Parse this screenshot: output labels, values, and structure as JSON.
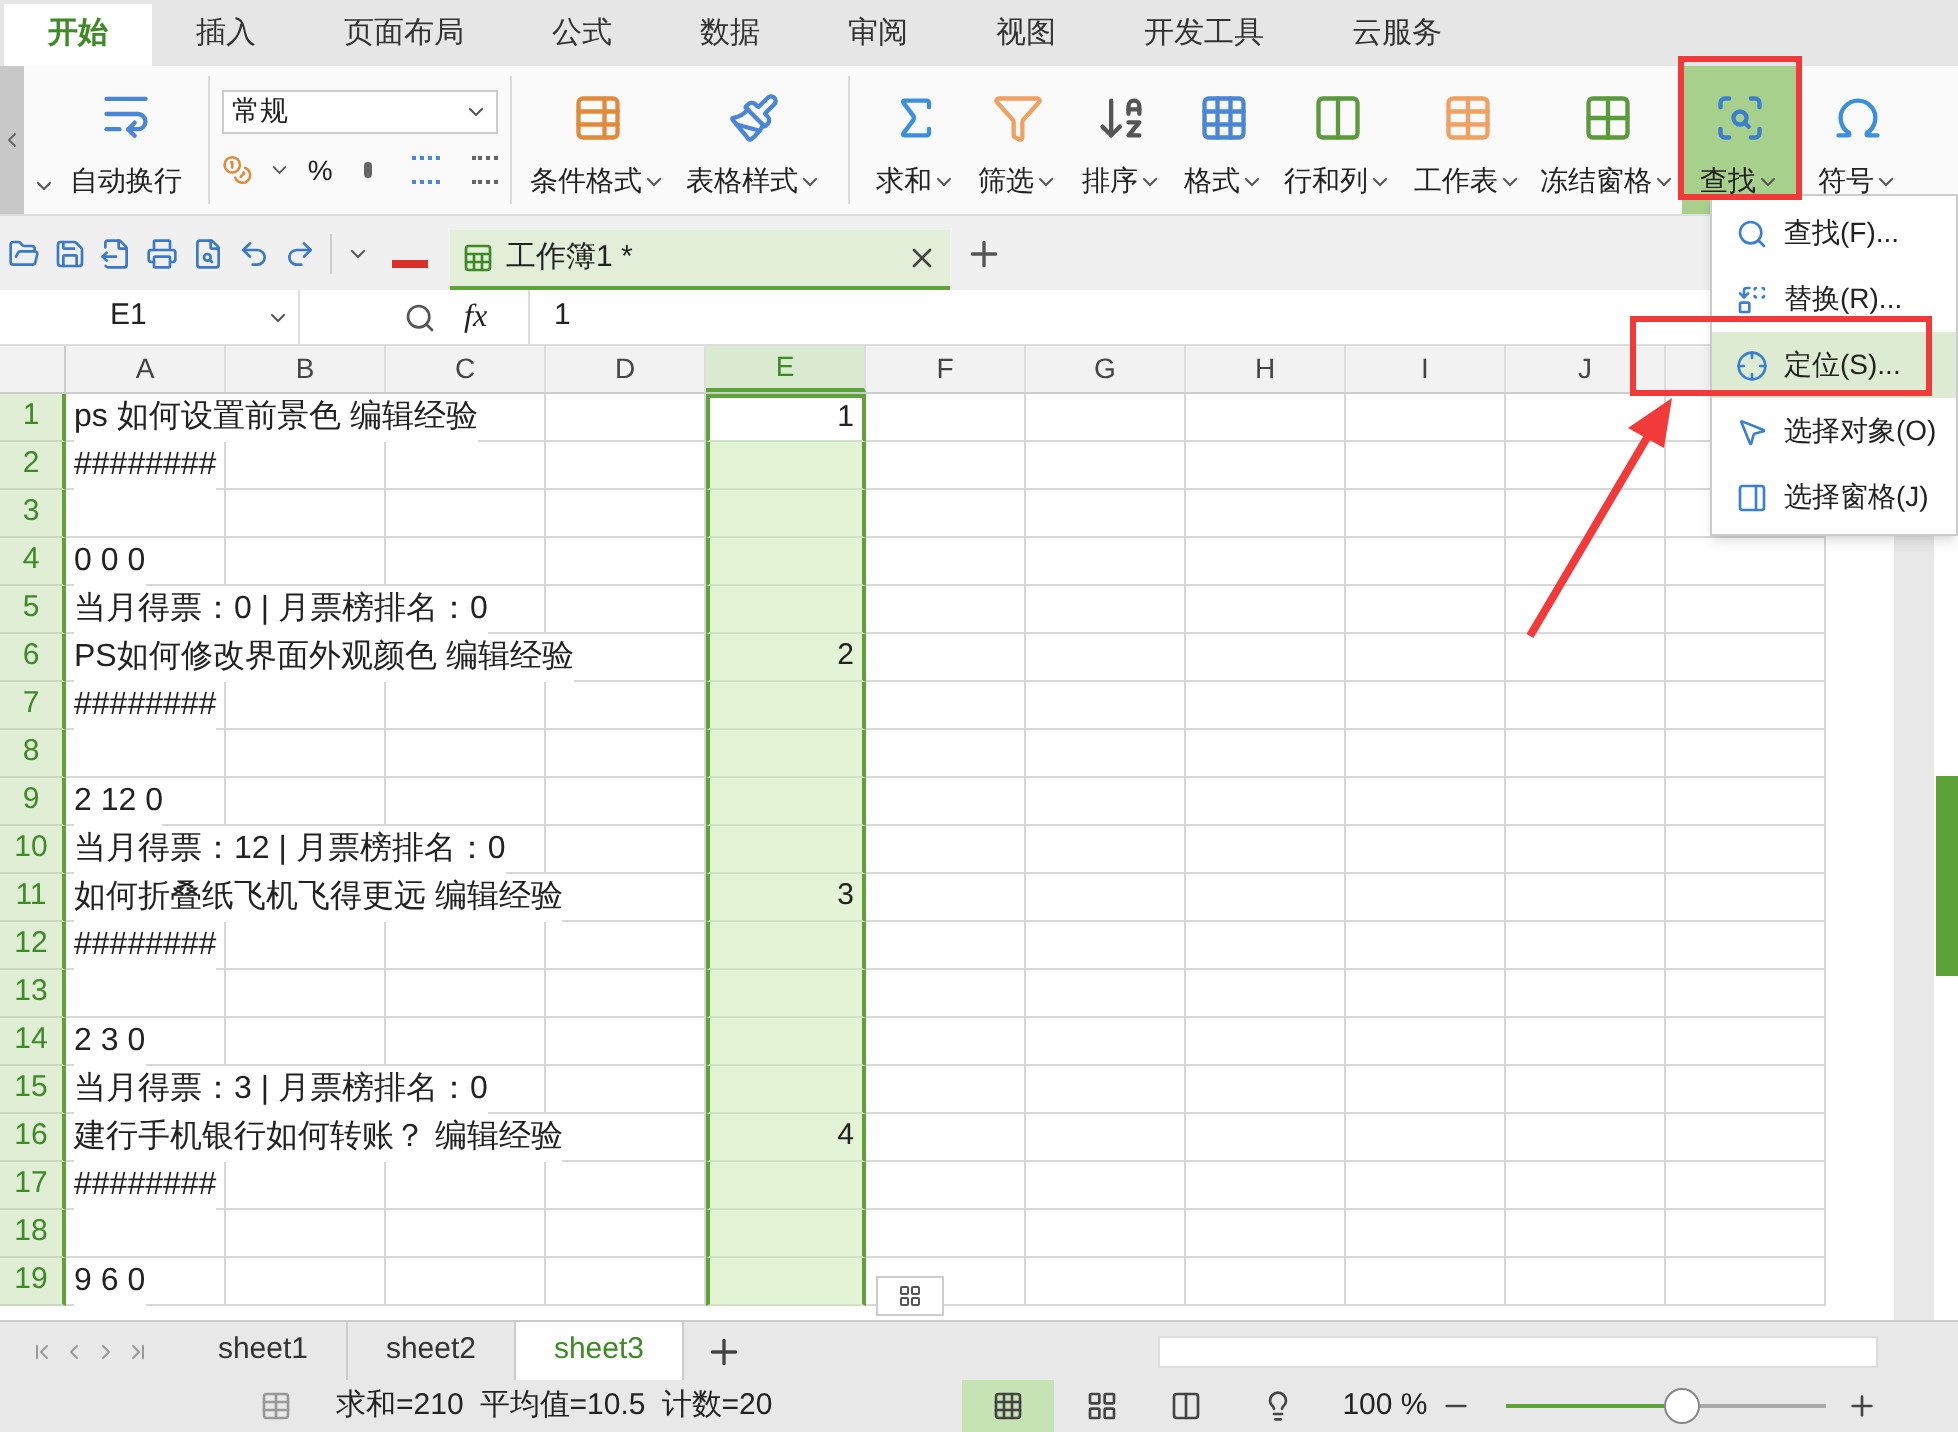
{
  "ribbon_tabs": [
    {
      "label": "开始",
      "selected": true
    },
    {
      "label": "插入",
      "selected": false
    },
    {
      "label": "页面布局",
      "selected": false
    },
    {
      "label": "公式",
      "selected": false
    },
    {
      "label": "数据",
      "selected": false
    },
    {
      "label": "审阅",
      "selected": false
    },
    {
      "label": "视图",
      "selected": false
    },
    {
      "label": "开发工具",
      "selected": false
    },
    {
      "label": "云服务",
      "selected": false
    }
  ],
  "ribbon": {
    "wrap_button": "自动换行",
    "number_format": "常规",
    "percent": "%",
    "buttons": [
      {
        "label": "条件格式",
        "selected": false
      },
      {
        "label": "表格样式",
        "selected": false
      },
      {
        "label": "求和",
        "selected": false
      },
      {
        "label": "筛选",
        "selected": false
      },
      {
        "label": "排序",
        "selected": false
      },
      {
        "label": "格式",
        "selected": false
      },
      {
        "label": "行和列",
        "selected": false
      },
      {
        "label": "工作表",
        "selected": false
      },
      {
        "label": "冻结窗格",
        "selected": false
      },
      {
        "label": "查找",
        "selected": true
      },
      {
        "label": "符号",
        "selected": false
      }
    ]
  },
  "document_tab": {
    "title": "工作簿1 *"
  },
  "formula_bar": {
    "name_box": "E1",
    "fx": "fx",
    "value": "1"
  },
  "columns": [
    {
      "label": "A",
      "selected": false
    },
    {
      "label": "B",
      "selected": false
    },
    {
      "label": "C",
      "selected": false
    },
    {
      "label": "D",
      "selected": false
    },
    {
      "label": "E",
      "selected": true
    },
    {
      "label": "F",
      "selected": false
    },
    {
      "label": "G",
      "selected": false
    },
    {
      "label": "H",
      "selected": false
    },
    {
      "label": "I",
      "selected": false
    },
    {
      "label": "J",
      "selected": false
    }
  ],
  "rows": [
    {
      "number": "1",
      "a": "ps 如何设置前景色 编辑经验",
      "e": "1"
    },
    {
      "number": "2",
      "a": "########",
      "e": ""
    },
    {
      "number": "3",
      "a": "",
      "e": ""
    },
    {
      "number": "4",
      "a": "0 0 0",
      "e": ""
    },
    {
      "number": "5",
      "a": "当月得票：0 | 月票榜排名：0",
      "e": ""
    },
    {
      "number": "6",
      "a": "PS如何修改界面外观颜色 编辑经验",
      "e": "2"
    },
    {
      "number": "7",
      "a": "########",
      "e": ""
    },
    {
      "number": "8",
      "a": "",
      "e": ""
    },
    {
      "number": "9",
      "a": "2 12 0",
      "e": ""
    },
    {
      "number": "10",
      "a": "当月得票：12 | 月票榜排名：0",
      "e": ""
    },
    {
      "number": "11",
      "a": "如何折叠纸飞机飞得更远 编辑经验",
      "e": "3"
    },
    {
      "number": "12",
      "a": "########",
      "e": ""
    },
    {
      "number": "13",
      "a": "",
      "e": ""
    },
    {
      "number": "14",
      "a": "2 3 0",
      "e": ""
    },
    {
      "number": "15",
      "a": "当月得票：3 | 月票榜排名：0",
      "e": ""
    },
    {
      "number": "16",
      "a": "建行手机银行如何转账？ 编辑经验",
      "e": "4"
    },
    {
      "number": "17",
      "a": "########",
      "e": ""
    },
    {
      "number": "18",
      "a": "",
      "e": ""
    },
    {
      "number": "19",
      "a": "9 6 0",
      "e": ""
    }
  ],
  "find_menu": [
    {
      "label": "查找(F)...",
      "selected": false
    },
    {
      "label": "替换(R)...",
      "selected": false
    },
    {
      "label": "定位(S)...",
      "selected": true
    },
    {
      "label": "选择对象(O)",
      "selected": false
    },
    {
      "label": "选择窗格(J)",
      "selected": false
    }
  ],
  "sheet_tabs": [
    {
      "label": "sheet1",
      "selected": false
    },
    {
      "label": "sheet2",
      "selected": false
    },
    {
      "label": "sheet3",
      "selected": true
    }
  ],
  "status_bar": {
    "sum": "求和=210",
    "average": "平均值=10.5",
    "count": "计数=20",
    "zoom": "100 %",
    "zoom_slider": {
      "level": 0.55
    }
  }
}
